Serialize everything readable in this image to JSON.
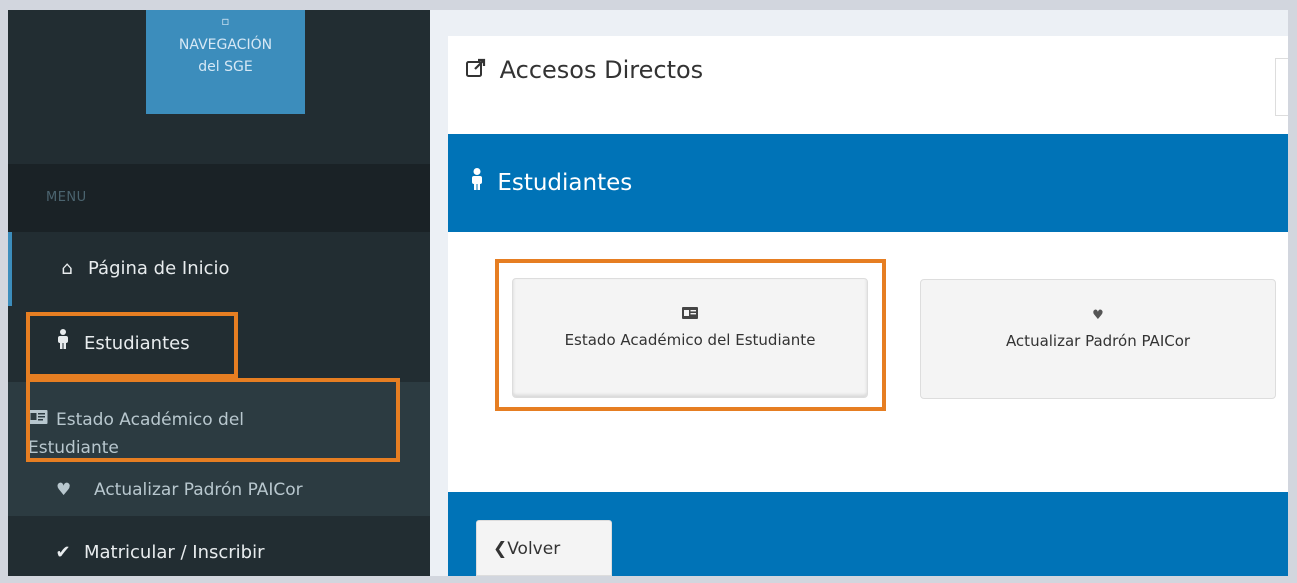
{
  "sidebar": {
    "nav_button": {
      "icon": "square-icon",
      "line1": "NAVEGACIÓN",
      "line2": "del SGE"
    },
    "menu_header": "MENU",
    "items": {
      "home": {
        "icon": "home-icon",
        "label": "Página de Inicio"
      },
      "students": {
        "icon": "student-icon",
        "label": "Estudiantes"
      },
      "matricular": {
        "icon": "check-icon",
        "label": "Matricular / Inscribir"
      }
    },
    "submenu": {
      "estado": {
        "icon": "id-card-icon",
        "label_line1": "Estado Académico del",
        "label_line2": "Estudiante"
      },
      "paicor": {
        "icon": "heart-icon",
        "label": "Actualizar Padrón PAICor"
      }
    }
  },
  "main": {
    "header": {
      "icon": "external-link-icon",
      "title": "Accesos Directos"
    },
    "section": {
      "icon": "student-icon",
      "title": "Estudiantes"
    },
    "cards": [
      {
        "icon": "id-card-icon",
        "label": "Estado Académico del Estudiante"
      },
      {
        "icon": "heart-icon",
        "label": "Actualizar Padrón PAICor"
      }
    ],
    "back_button": {
      "icon": "chevron-left-icon",
      "label": "Volver"
    }
  },
  "colors": {
    "sidebar_bg": "#222d32",
    "accent": "#0073b7",
    "nav_button": "#3c8dbc",
    "highlight": "#e67e22"
  }
}
